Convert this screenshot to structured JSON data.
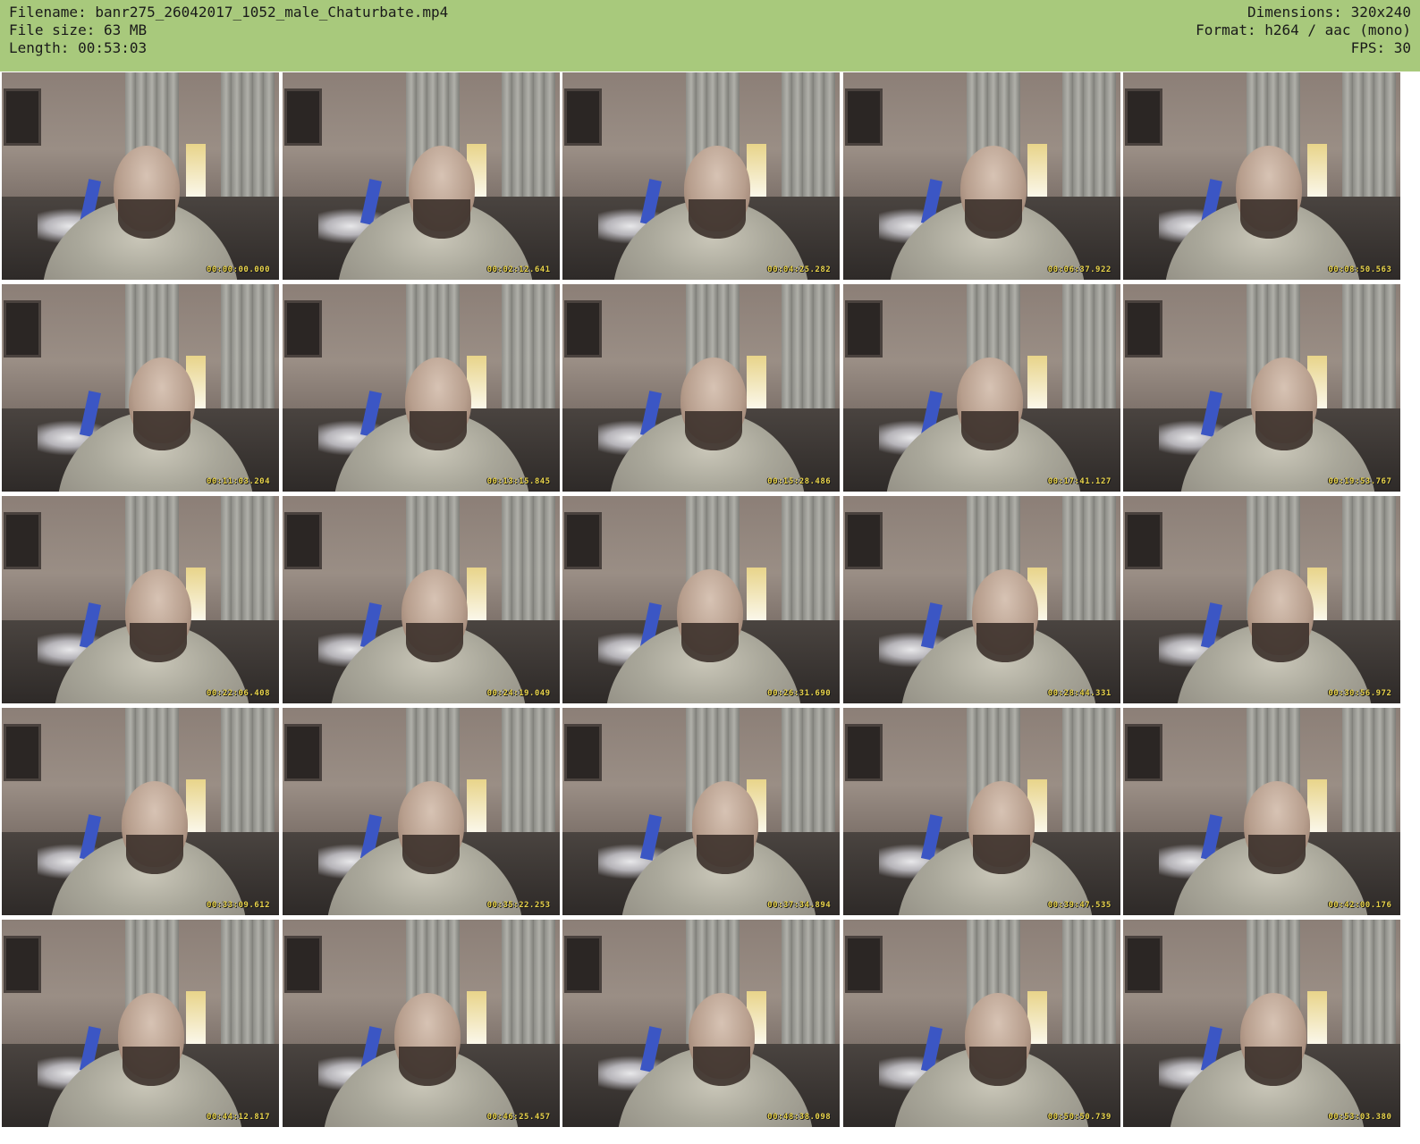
{
  "header": {
    "filename": "Filename: banr275_26042017_1052_male_Chaturbate.mp4",
    "filesize": "File size: 63 MB",
    "length": "Length: 00:53:03",
    "dimensions": "Dimensions: 320x240",
    "format": "Format: h264 / aac (mono)",
    "fps": "FPS: 30"
  },
  "colors": {
    "header_background": "#a8c97c",
    "timestamp_text": "#e9d34a"
  },
  "grid": {
    "columns": 5,
    "rows": 5
  },
  "thumbnails": [
    {
      "timestamp": "00:00:00.000"
    },
    {
      "timestamp": "00:02:12.641"
    },
    {
      "timestamp": "00:04:25.282"
    },
    {
      "timestamp": "00:06:37.922"
    },
    {
      "timestamp": "00:08:50.563"
    },
    {
      "timestamp": "00:11:03.204"
    },
    {
      "timestamp": "00:13:15.845"
    },
    {
      "timestamp": "00:15:28.486"
    },
    {
      "timestamp": "00:17:41.127"
    },
    {
      "timestamp": "00:19:53.767"
    },
    {
      "timestamp": "00:22:06.408"
    },
    {
      "timestamp": "00:24:19.049"
    },
    {
      "timestamp": "00:26:31.690"
    },
    {
      "timestamp": "00:28:44.331"
    },
    {
      "timestamp": "00:30:56.972"
    },
    {
      "timestamp": "00:33:09.612"
    },
    {
      "timestamp": "00:35:22.253"
    },
    {
      "timestamp": "00:37:34.894"
    },
    {
      "timestamp": "00:39:47.535"
    },
    {
      "timestamp": "00:42:00.176"
    },
    {
      "timestamp": "00:44:12.817"
    },
    {
      "timestamp": "00:46:25.457"
    },
    {
      "timestamp": "00:48:38.098"
    },
    {
      "timestamp": "00:50:50.739"
    },
    {
      "timestamp": "00:53:03.380"
    }
  ]
}
